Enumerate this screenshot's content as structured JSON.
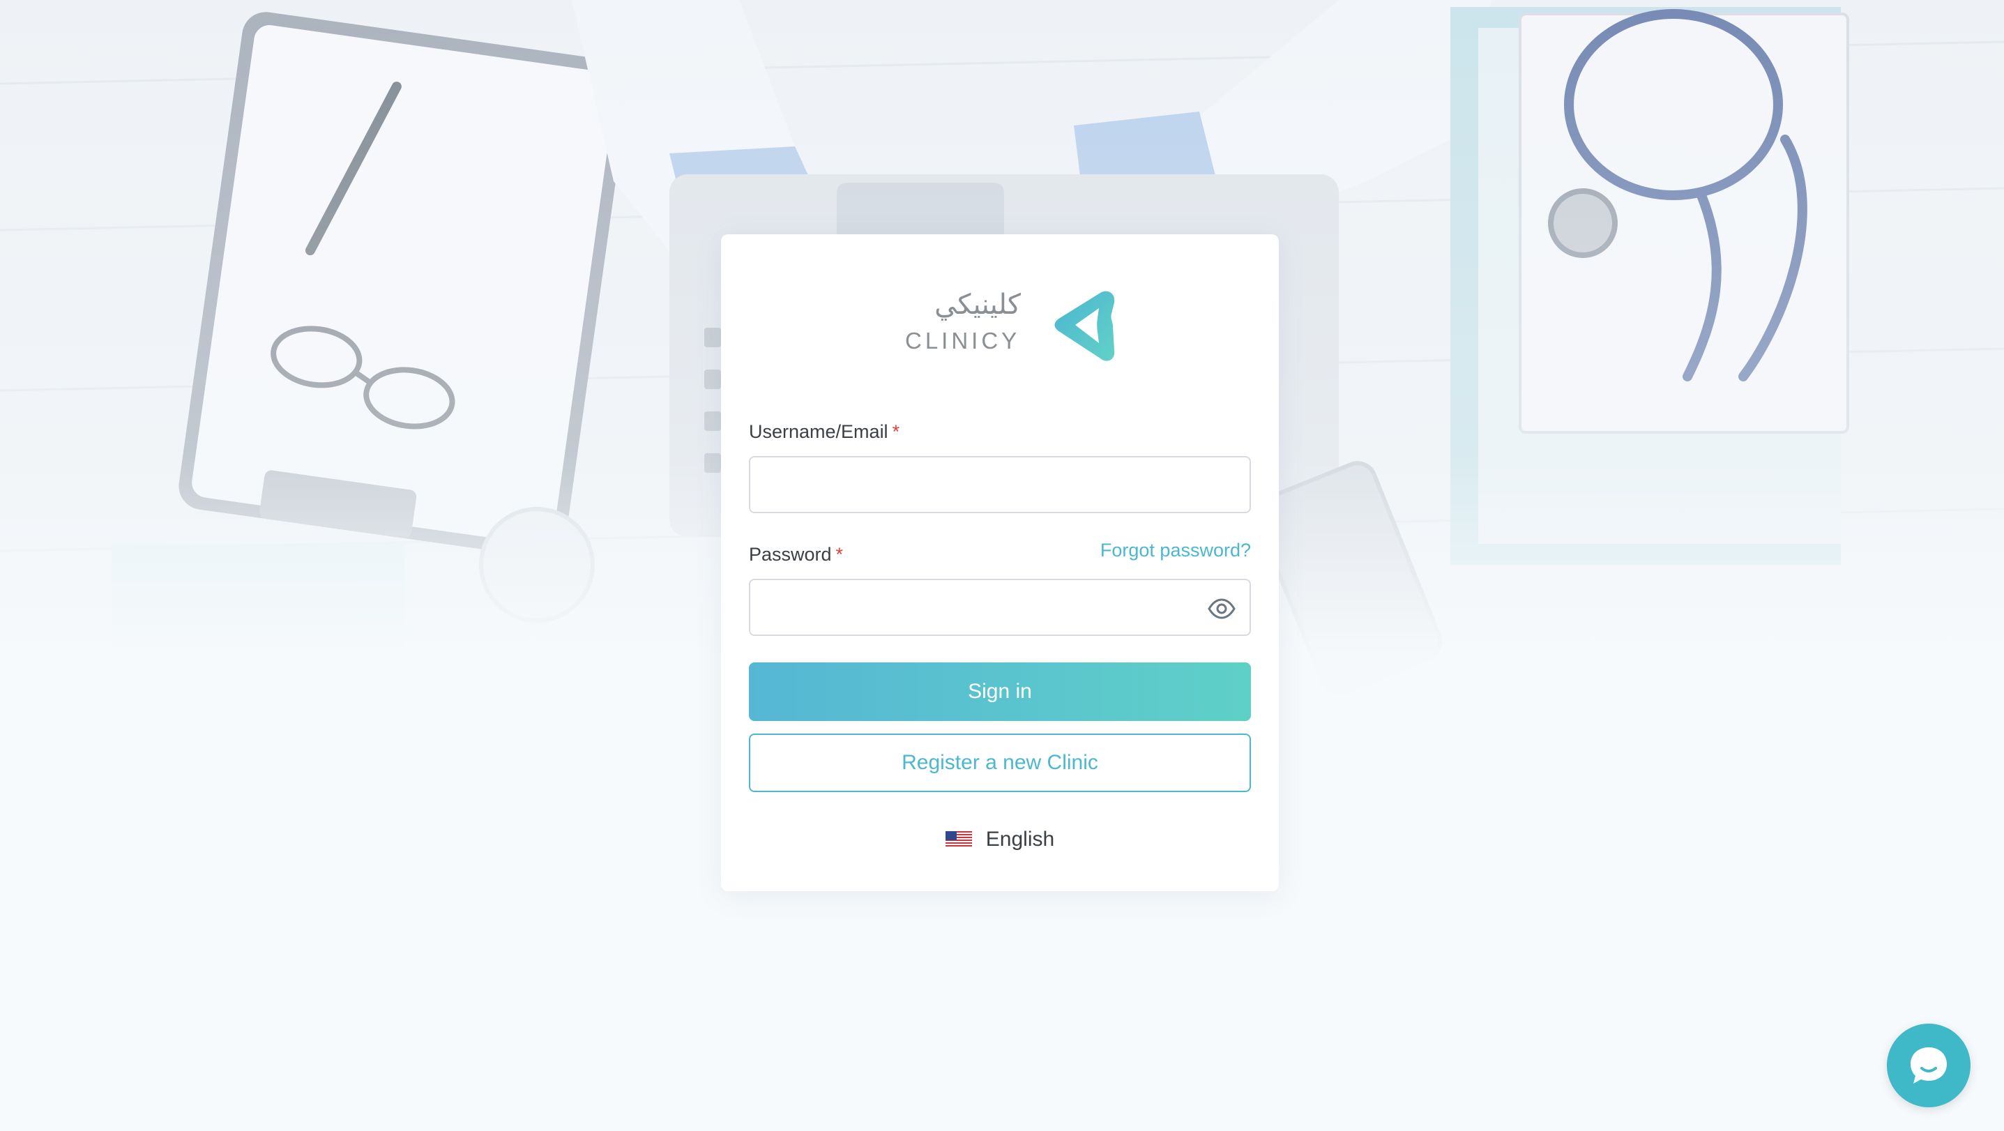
{
  "brand": {
    "name_arabic": "كلينيكي",
    "name_latin": "CLINICY",
    "accent_color": "#4cb8cf",
    "gradient_start": "#55b7d4",
    "gradient_end": "#5fd0c8"
  },
  "form": {
    "username": {
      "label": "Username/Email",
      "required_mark": "*",
      "value": "",
      "placeholder": ""
    },
    "password": {
      "label": "Password",
      "required_mark": "*",
      "value": "",
      "placeholder": "",
      "toggle_icon": "eye-icon"
    },
    "forgot_password": "Forgot password?",
    "sign_in": "Sign in",
    "register": "Register a new Clinic"
  },
  "language": {
    "flag_icon": "us-flag-icon",
    "label": "English"
  },
  "chat": {
    "icon": "chat-bubble-icon",
    "color": "#3fb8c8"
  },
  "background": {
    "description_icons": [
      "clipboard",
      "pen",
      "glasses",
      "laptop",
      "stethoscope",
      "phone",
      "books"
    ]
  }
}
